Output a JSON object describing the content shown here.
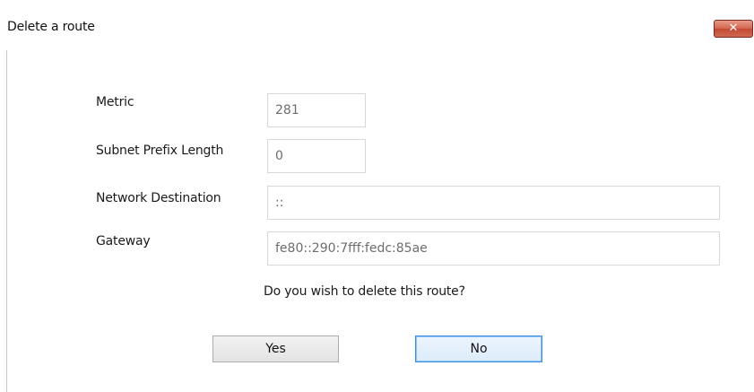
{
  "window": {
    "title": "Delete a route",
    "close_icon": "close-icon",
    "close_glyph": "✕"
  },
  "form": {
    "metric": {
      "label": "Metric",
      "value": "281"
    },
    "subnet_prefix_length": {
      "label": "Subnet Prefix Length",
      "value": "0"
    },
    "network_destination": {
      "label": "Network Destination",
      "value": "::"
    },
    "gateway": {
      "label": "Gateway",
      "value": "fe80::290:7fff:fedc:85ae"
    }
  },
  "prompt": "Do you wish to delete this route?",
  "buttons": {
    "yes": "Yes",
    "no": "No"
  },
  "colors": {
    "close_button": "#d56750",
    "default_button_border": "#3d8ee0",
    "field_text": "#6d6d6d"
  }
}
